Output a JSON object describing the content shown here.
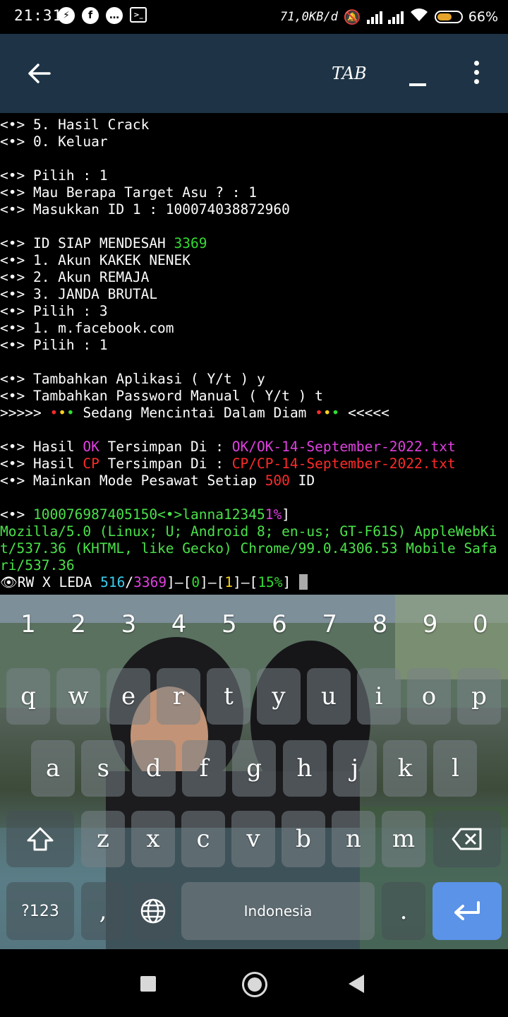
{
  "status_bar": {
    "time": "21:31",
    "network_speed": "71,0KB/d",
    "battery": "66%",
    "battery_level": 0.66
  },
  "app_bar": {
    "tab_label": "TAB"
  },
  "terminal": {
    "lines": [
      {
        "segments": [
          {
            "t": "<•> 5. Hasil Crack"
          }
        ]
      },
      {
        "segments": [
          {
            "t": "<•> 0. Keluar"
          }
        ]
      },
      {
        "segments": [
          {
            "t": ""
          }
        ]
      },
      {
        "segments": [
          {
            "t": "<•> Pilih : 1"
          }
        ]
      },
      {
        "segments": [
          {
            "t": "<•> Mau Berapa Target Asu ? : 1"
          }
        ]
      },
      {
        "segments": [
          {
            "t": "<•> Masukkan ID 1 : 100074038872960"
          }
        ]
      },
      {
        "segments": [
          {
            "t": ""
          }
        ]
      },
      {
        "segments": [
          {
            "t": "<•> ID SIAP MENDESAH "
          },
          {
            "t": "3369",
            "c": "g"
          }
        ]
      },
      {
        "segments": [
          {
            "t": "<•> 1. Akun KAKEK NENEK"
          }
        ]
      },
      {
        "segments": [
          {
            "t": "<•> 2. Akun REMAJA"
          }
        ]
      },
      {
        "segments": [
          {
            "t": "<•> 3. JANDA BRUTAL"
          }
        ]
      },
      {
        "segments": [
          {
            "t": "<•> Pilih : 3"
          }
        ]
      },
      {
        "segments": [
          {
            "t": "<•> 1. m.facebook.com"
          }
        ]
      },
      {
        "segments": [
          {
            "t": "<•> Pilih : 1"
          }
        ]
      },
      {
        "segments": [
          {
            "t": ""
          }
        ]
      },
      {
        "segments": [
          {
            "t": "<•> Tambahkan Aplikasi ( Y/t ) y"
          }
        ]
      },
      {
        "segments": [
          {
            "t": "<•> Tambahkan Password Manual ( Y/t ) t"
          }
        ]
      },
      {
        "segments": [
          {
            "t": ">>>>> "
          },
          {
            "t": "•",
            "c": "dot-r"
          },
          {
            "t": "•",
            "c": "dot-y"
          },
          {
            "t": "•",
            "c": "dot-g"
          },
          {
            "t": " Sedang Mencintai Dalam Diam "
          },
          {
            "t": "•",
            "c": "dot-r"
          },
          {
            "t": "•",
            "c": "dot-y"
          },
          {
            "t": "•",
            "c": "dot-g"
          },
          {
            "t": " <<<<<"
          }
        ]
      },
      {
        "segments": [
          {
            "t": ""
          }
        ]
      },
      {
        "segments": [
          {
            "t": "<•> Hasil "
          },
          {
            "t": "OK",
            "c": "m"
          },
          {
            "t": " Tersimpan Di : "
          },
          {
            "t": "OK/OK-14-September-2022.txt",
            "c": "m"
          }
        ]
      },
      {
        "segments": [
          {
            "t": "<•> Hasil "
          },
          {
            "t": "CP",
            "c": "r"
          },
          {
            "t": " Tersimpan Di : "
          },
          {
            "t": "CP/CP-14-September-2022.txt",
            "c": "r"
          }
        ]
      },
      {
        "segments": [
          {
            "t": "<•> Mainkan Mode Pesawat Setiap "
          },
          {
            "t": "500",
            "c": "r"
          },
          {
            "t": " ID"
          }
        ]
      },
      {
        "segments": [
          {
            "t": ""
          }
        ]
      },
      {
        "segments": [
          {
            "t": "<•> "
          },
          {
            "t": "100076987405150<•>lanna12345",
            "c": "gg"
          },
          {
            "t": "1%",
            "c": "m"
          },
          {
            "t": "]"
          }
        ]
      },
      {
        "segments": [
          {
            "t": "Mozilla/5.0 (Linux; U; Android 8; en-us; GT-F61S) AppleWebKi",
            "c": "gg"
          }
        ]
      },
      {
        "segments": [
          {
            "t": "t/537.36 (KHTML, like Gecko) Chrome/99.0.4306.53 Mobile Safa",
            "c": "gg"
          }
        ]
      },
      {
        "segments": [
          {
            "t": "ri/537.36",
            "c": "gg"
          }
        ]
      },
      {
        "segments": [
          {
            "t": "👁RW X LEDA "
          },
          {
            "t": "516",
            "c": "c"
          },
          {
            "t": "/"
          },
          {
            "t": "3369",
            "c": "m"
          },
          {
            "t": "]–["
          },
          {
            "t": "0",
            "c": "g"
          },
          {
            "t": "]–["
          },
          {
            "t": "1",
            "c": "y"
          },
          {
            "t": "]–["
          },
          {
            "t": "15%",
            "c": "g"
          },
          {
            "t": "] "
          }
        ],
        "cursor": true
      }
    ]
  },
  "keyboard": {
    "number_row": [
      "1",
      "2",
      "3",
      "4",
      "5",
      "6",
      "7",
      "8",
      "9",
      "0"
    ],
    "row1": [
      "q",
      "w",
      "e",
      "r",
      "t",
      "y",
      "u",
      "i",
      "o",
      "p"
    ],
    "row2": [
      "a",
      "s",
      "d",
      "f",
      "g",
      "h",
      "j",
      "k",
      "l"
    ],
    "row3": [
      "z",
      "x",
      "c",
      "v",
      "b",
      "n",
      "m"
    ],
    "symbols_label": "?123",
    "comma": ",",
    "space_label": "Indonesia",
    "period": "."
  }
}
